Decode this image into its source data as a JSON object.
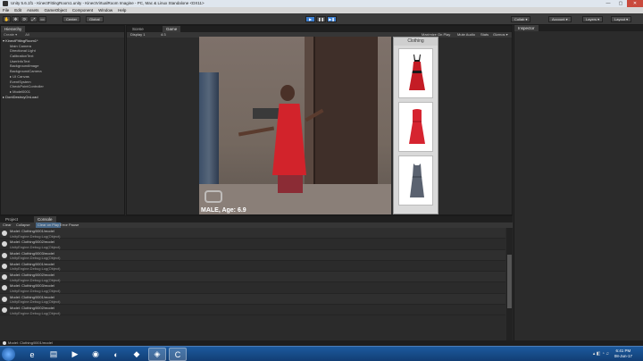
{
  "window": {
    "title": "Unity 5.6.1f1 - KinectFittingRoom1.unity - KinectVirtualRoom Imagine - PC, Mac & Linux Standalone <DX11>",
    "minimize": "—",
    "maximize": "▢",
    "close": "✕"
  },
  "menu": [
    "File",
    "Edit",
    "Assets",
    "GameObject",
    "Component",
    "Window",
    "Help"
  ],
  "toolbar": {
    "tools": [
      "✋",
      "✥",
      "⟳",
      "⤢",
      "▭"
    ],
    "pivot": "Center",
    "space": "Global",
    "play": "▶",
    "pause": "❚❚",
    "step": "▶❚",
    "collab": "Collab ▾",
    "account": "Account ▾",
    "layers": "Layers ▾",
    "layout": "Layout ▾"
  },
  "hierarchy": {
    "tab": "Hierarchy",
    "create": "Create ▾",
    "search": "All",
    "items": [
      {
        "label": "▾ KinectFittingRoom1*",
        "type": "root"
      },
      {
        "label": "Main Camera",
        "type": "indent"
      },
      {
        "label": "Directional Light",
        "type": "indent"
      },
      {
        "label": "CalibrationText",
        "type": "indent"
      },
      {
        "label": "UserInfoText",
        "type": "indent"
      },
      {
        "label": "BackgroundImage",
        "type": "indent"
      },
      {
        "label": "BackgroundCamera",
        "type": "indent"
      },
      {
        "label": "▸ UI Canvas",
        "type": "indent"
      },
      {
        "label": "EventSystem",
        "type": "indent"
      },
      {
        "label": "CheckPointController",
        "type": "indent"
      },
      {
        "label": "▸ Model0001",
        "type": "indent"
      },
      {
        "label": "▸ DontDestroyOnLoad",
        "type": "root"
      }
    ]
  },
  "scene_tabs": {
    "scene": "Scene",
    "game": "Game",
    "display": "Display 1",
    "aspect": "4:3"
  },
  "game_options": {
    "maximize": "Maximize On Play",
    "mute": "Mute Audio",
    "stats": "Stats",
    "gizmos": "Gizmos ▾"
  },
  "camera": {
    "overlay_text": "MALE, Age: 6.9"
  },
  "clothing": {
    "title": "Clothing",
    "items": [
      {
        "name": "red-strap-dress",
        "color": "#c41c25",
        "accent": "#1a1a1a"
      },
      {
        "name": "red-strapless-dress",
        "color": "#d62430",
        "accent": "#b81b26"
      },
      {
        "name": "grey-sleeveless-dress",
        "color": "#5a6270",
        "accent": "#48505c"
      }
    ]
  },
  "inspector": {
    "tab": "Inspector"
  },
  "console": {
    "tabs": [
      "Project",
      "Console"
    ],
    "buttons": {
      "clear": "Clear",
      "collapse": "Collapse",
      "clear_on_play": "Clear on Play",
      "error_pause": "Error Pause"
    },
    "logs": [
      {
        "line1": "Model: Clothing/0001/model",
        "line2": "UnityEngine.Debug:Log(Object)"
      },
      {
        "line1": "Model: Clothing/0002/model",
        "line2": "UnityEngine.Debug:Log(Object)"
      },
      {
        "line1": "Model: Clothing/0003/model",
        "line2": "UnityEngine.Debug:Log(Object)"
      },
      {
        "line1": "Model: Clothing/0001/model",
        "line2": "UnityEngine.Debug:Log(Object)"
      },
      {
        "line1": "Model: Clothing/0002/model",
        "line2": "UnityEngine.Debug:Log(Object)"
      },
      {
        "line1": "Model: Clothing/0003/model",
        "line2": "UnityEngine.Debug:Log(Object)"
      },
      {
        "line1": "Model: Clothing/0001/model",
        "line2": "UnityEngine.Debug:Log(Object)"
      },
      {
        "line1": "Model: Clothing/0002/model",
        "line2": "UnityEngine.Debug:Log(Object)"
      }
    ]
  },
  "status": {
    "message": "Model: Clothing/0001/model"
  },
  "taskbar": {
    "apps": [
      {
        "name": "ie-icon",
        "glyph": "e"
      },
      {
        "name": "explorer-icon",
        "glyph": "▤"
      },
      {
        "name": "media-icon",
        "glyph": "▶"
      },
      {
        "name": "chrome-icon",
        "glyph": "◉"
      },
      {
        "name": "firefox-icon",
        "glyph": "◐"
      },
      {
        "name": "app-icon",
        "glyph": "◆"
      },
      {
        "name": "unity-icon",
        "glyph": "◈"
      },
      {
        "name": "camtasia-icon",
        "glyph": "C"
      }
    ],
    "time": "6:41 PM",
    "date": "08-Jun-17"
  }
}
